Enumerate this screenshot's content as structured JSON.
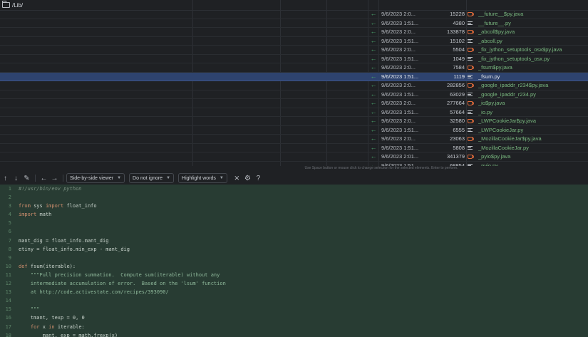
{
  "path": {
    "label": "/Lib/"
  },
  "files": [
    {
      "arrow": "←",
      "date": "9/6/2023 2:0...",
      "size": "15228",
      "icon": "java-cup-icon",
      "name": "__future__$py.java"
    },
    {
      "arrow": "←",
      "date": "9/6/2023 1:51...",
      "size": "4380",
      "icon": "text-file-icon",
      "name": "__future__.py"
    },
    {
      "arrow": "←",
      "date": "9/6/2023 2:0...",
      "size": "133878",
      "icon": "java-cup-icon",
      "name": "_abcoll$py.java"
    },
    {
      "arrow": "←",
      "date": "9/6/2023 1:51...",
      "size": "15102",
      "icon": "text-file-icon",
      "name": "_abcoll.py"
    },
    {
      "arrow": "←",
      "date": "9/6/2023 2:0...",
      "size": "5504",
      "icon": "java-cup-icon",
      "name": "_fix_jython_setuptools_osx$py.java"
    },
    {
      "arrow": "←",
      "date": "9/6/2023 1:51...",
      "size": "1049",
      "icon": "text-file-icon",
      "name": "_fix_jython_setuptools_osx.py"
    },
    {
      "arrow": "←",
      "date": "9/6/2023 2:0...",
      "size": "7584",
      "icon": "java-cup-icon",
      "name": "_fsum$py.java"
    },
    {
      "arrow": "←",
      "date": "9/6/2023 1:51...",
      "size": "1119",
      "icon": "text-file-icon",
      "name": "_fsum.py",
      "selected": true
    },
    {
      "arrow": "←",
      "date": "9/6/2023 2:0...",
      "size": "282856",
      "icon": "java-cup-icon",
      "name": "_google_ipaddr_r234$py.java"
    },
    {
      "arrow": "←",
      "date": "9/6/2023 1:51...",
      "size": "63029",
      "icon": "text-file-icon",
      "name": "_google_ipaddr_r234.py"
    },
    {
      "arrow": "←",
      "date": "9/6/2023 2:0...",
      "size": "277664",
      "icon": "java-cup-icon",
      "name": "_io$py.java"
    },
    {
      "arrow": "←",
      "date": "9/6/2023 1:51...",
      "size": "57664",
      "icon": "text-file-icon",
      "name": "_io.py"
    },
    {
      "arrow": "←",
      "date": "9/6/2023 2:0...",
      "size": "32580",
      "icon": "java-cup-icon",
      "name": "_LWPCookieJar$py.java"
    },
    {
      "arrow": "←",
      "date": "9/6/2023 1:51...",
      "size": "6555",
      "icon": "text-file-icon",
      "name": "_LWPCookieJar.py"
    },
    {
      "arrow": "←",
      "date": "9/6/2023 2:0...",
      "size": "23063",
      "icon": "java-cup-icon",
      "name": "_MozillaCookieJar$py.java"
    },
    {
      "arrow": "←",
      "date": "9/6/2023 1:51...",
      "size": "5808",
      "icon": "text-file-icon",
      "name": "_MozillaCookieJar.py"
    },
    {
      "arrow": "←",
      "date": "9/6/2023 2:01...",
      "size": "341379",
      "icon": "java-cup-icon",
      "name": "_pyio$py.java"
    },
    {
      "arrow": "←",
      "date": "9/6/2023 1:51...",
      "size": "68854",
      "icon": "text-file-icon",
      "name": "_pyio.py"
    },
    {
      "arrow": "←",
      "date": "9/6/2023 2:01...",
      "size": "16178",
      "icon": "java-cup-icon",
      "name": "_rawffi$py.java"
    }
  ],
  "hint": "Use Space button or mouse click to change selection for the selected elements. Enter to perform.",
  "toolbar": {
    "viewer": "Side-by-side viewer",
    "ignore": "Do not ignore",
    "highlight": "Highlight words",
    "help": "?"
  },
  "code": [
    {
      "n": "1",
      "t": "#!/usr/bin/env python"
    },
    {
      "n": "",
      "t": ""
    },
    {
      "n": "",
      "t": "from sys import float_info"
    },
    {
      "n": "",
      "t": "import math"
    },
    {
      "n": "",
      "t": ""
    },
    {
      "n": "",
      "t": ""
    },
    {
      "n": "",
      "t": "mant_dig = float_info.mant_dig"
    },
    {
      "n": "",
      "t": "etiny = float_info.min_exp - mant_dig"
    },
    {
      "n": "",
      "t": ""
    },
    {
      "n": "",
      "t": "def fsum(iterable):"
    },
    {
      "n": "",
      "t": "    \"\"\"Full precision summation.  Compute sum(iterable) without any"
    },
    {
      "n": "",
      "t": "    intermediate accumulation of error.  Based on the 'lsum' function"
    },
    {
      "n": "",
      "t": "    at http://code.activestate.com/recipes/393090/"
    },
    {
      "n": "",
      "t": ""
    },
    {
      "n": "",
      "t": "    \"\"\""
    },
    {
      "n": "",
      "t": "    tmant, texp = 0, 0"
    },
    {
      "n": "",
      "t": "    for x in iterable:"
    },
    {
      "n": "",
      "t": "        mant, exp = math.frexp(x)"
    }
  ],
  "colors": {
    "selection": "#2e436e",
    "diff_bg": "#283c33",
    "arrow": "#4aa36b",
    "java_icon": "#e06b3a",
    "filename": "#79b87f"
  }
}
